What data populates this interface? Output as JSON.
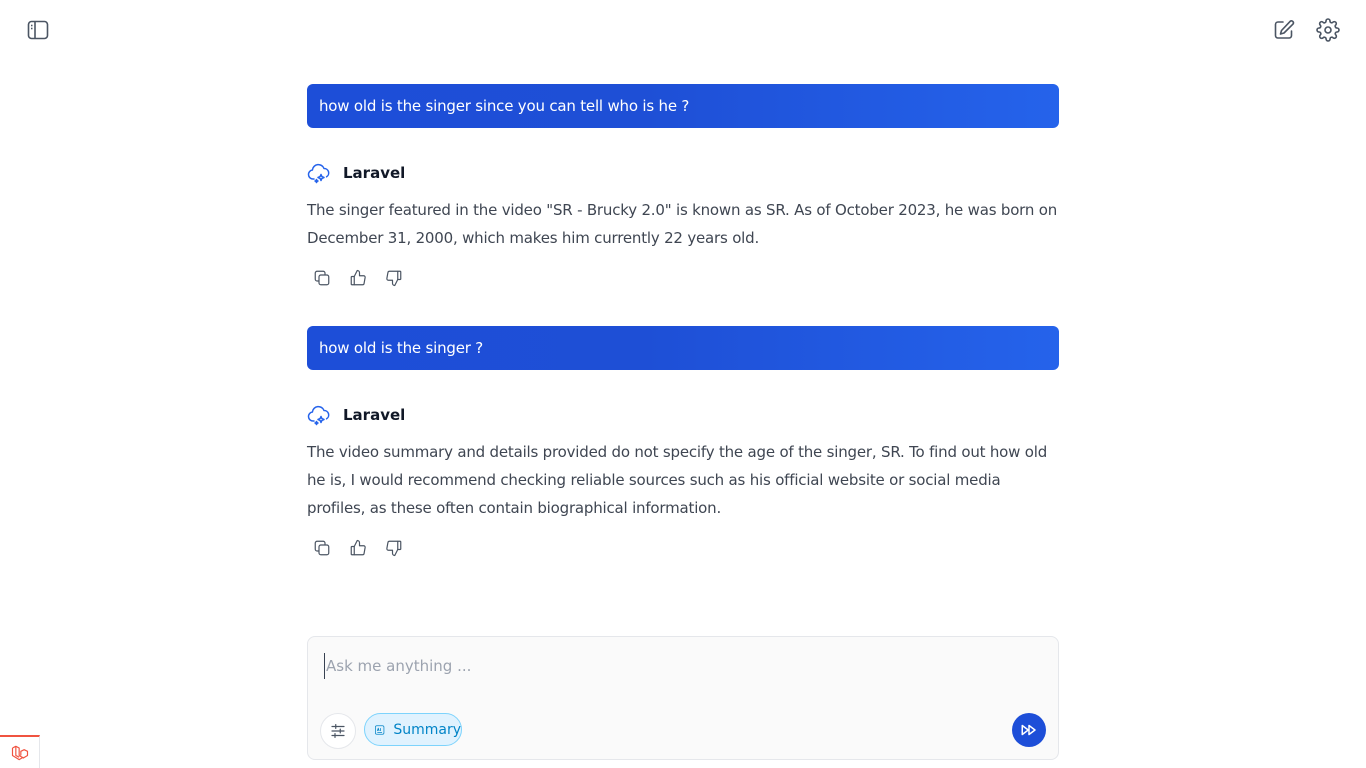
{
  "topbar": {
    "sidebar_toggle_icon": "sidebar-toggle-icon",
    "new_chat_icon": "edit-icon",
    "settings_icon": "gear-icon"
  },
  "conversation": {
    "messages": [
      {
        "role": "user",
        "text": "how old is the singer since you can tell who is he ?"
      },
      {
        "role": "assistant",
        "name": "Laravel",
        "text": "The singer featured in the video \"SR - Brucky 2.0\" is known as SR. As of October 2023, he was born on December 31, 2000, which makes him currently 22 years old."
      },
      {
        "role": "user",
        "text": "how old is the singer ?"
      },
      {
        "role": "assistant",
        "name": "Laravel",
        "text": "The video summary and details provided do not specify the age of the singer, SR. To find out how old he is, I would recommend checking reliable sources such as his official website or social media profiles, as these often contain biographical information."
      }
    ],
    "action_icons": [
      "copy-icon",
      "thumbs-up-icon",
      "thumbs-down-icon"
    ]
  },
  "composer": {
    "placeholder": "Ask me anything ...",
    "value": "",
    "summary_label": "Summary",
    "tools_icon": "sliders-icon",
    "send_icon": "fast-forward-icon"
  },
  "colors": {
    "accent": "#1d4ed8",
    "user_bubble_start": "#1d4ed8",
    "user_bubble_end": "#2563eb",
    "chip_bg": "#e0f2fe",
    "chip_text": "#0284c7",
    "laravel_red": "#f05340"
  }
}
